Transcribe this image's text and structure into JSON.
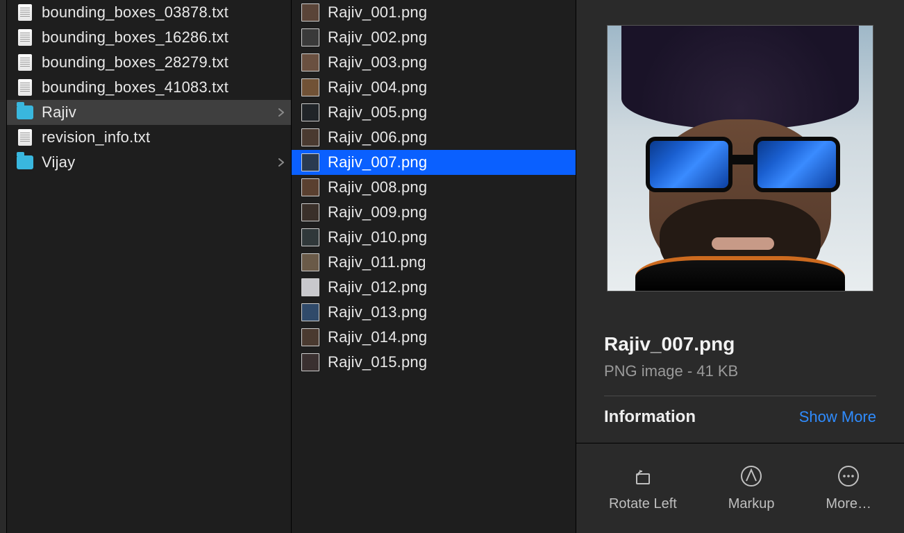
{
  "col1": {
    "items": [
      {
        "type": "txt",
        "name": "bounding_boxes_03878.txt"
      },
      {
        "type": "txt",
        "name": "bounding_boxes_16286.txt"
      },
      {
        "type": "txt",
        "name": "bounding_boxes_28279.txt"
      },
      {
        "type": "txt",
        "name": "bounding_boxes_41083.txt"
      },
      {
        "type": "folder",
        "name": "Rajiv",
        "selected": true,
        "expandable": true
      },
      {
        "type": "txt",
        "name": "revision_info.txt"
      },
      {
        "type": "folder",
        "name": "Vijay",
        "expandable": true
      }
    ]
  },
  "col2": {
    "items": [
      {
        "name": "Rajiv_001.png"
      },
      {
        "name": "Rajiv_002.png"
      },
      {
        "name": "Rajiv_003.png"
      },
      {
        "name": "Rajiv_004.png"
      },
      {
        "name": "Rajiv_005.png"
      },
      {
        "name": "Rajiv_006.png"
      },
      {
        "name": "Rajiv_007.png",
        "selected": true
      },
      {
        "name": "Rajiv_008.png"
      },
      {
        "name": "Rajiv_009.png"
      },
      {
        "name": "Rajiv_010.png"
      },
      {
        "name": "Rajiv_011.png"
      },
      {
        "name": "Rajiv_012.png"
      },
      {
        "name": "Rajiv_013.png"
      },
      {
        "name": "Rajiv_014.png"
      },
      {
        "name": "Rajiv_015.png"
      }
    ]
  },
  "preview": {
    "filename": "Rajiv_007.png",
    "subtitle": "PNG image - 41 KB",
    "info_label": "Information",
    "show_more": "Show More"
  },
  "actions": {
    "rotate": "Rotate Left",
    "markup": "Markup",
    "more": "More…"
  }
}
